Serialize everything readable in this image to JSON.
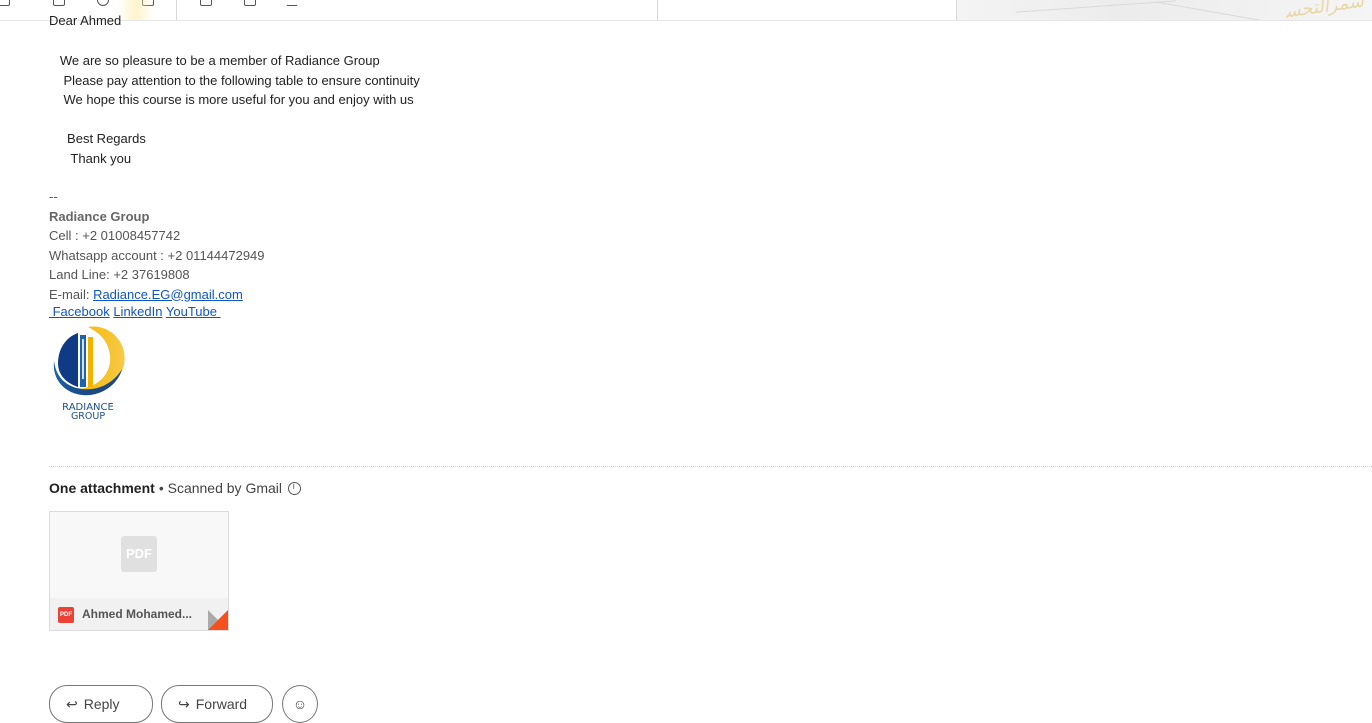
{
  "email": {
    "greeting": "Dear Ahmed",
    "body": [
      "   We are so pleasure to be a member of Radiance Group",
      "    Please pay attention to the following table to ensure continuity",
      "    We hope this course is more useful for you and enjoy with us",
      "",
      "     Best Regards",
      "      Thank you"
    ],
    "signature": {
      "dashes": "--",
      "company": "Radiance Group",
      "cell": "Cell : +2 01008457742",
      "whatsapp": "Whatsapp account : +2 01144472949",
      "landline": "Land Line: +2 37619808",
      "email_label": "E-mail: ",
      "email_link": "Radiance.EG@gmail.com",
      "links": [
        " Facebook",
        "LinkedIn",
        "YouTube "
      ],
      "logo_text_1": "RADIANCE",
      "logo_text_2": "GROUP"
    }
  },
  "attachments": {
    "count_label": "One attachment",
    "scanned_label": "• Scanned by Gmail",
    "file_name": "Ahmed Mohamed...",
    "preview_label": "PDF",
    "small_label": "PDF"
  },
  "actions": {
    "reply": "Reply",
    "forward": "Forward"
  },
  "colors": {
    "link": "#1155cc",
    "pdf_red": "#ea4335"
  }
}
